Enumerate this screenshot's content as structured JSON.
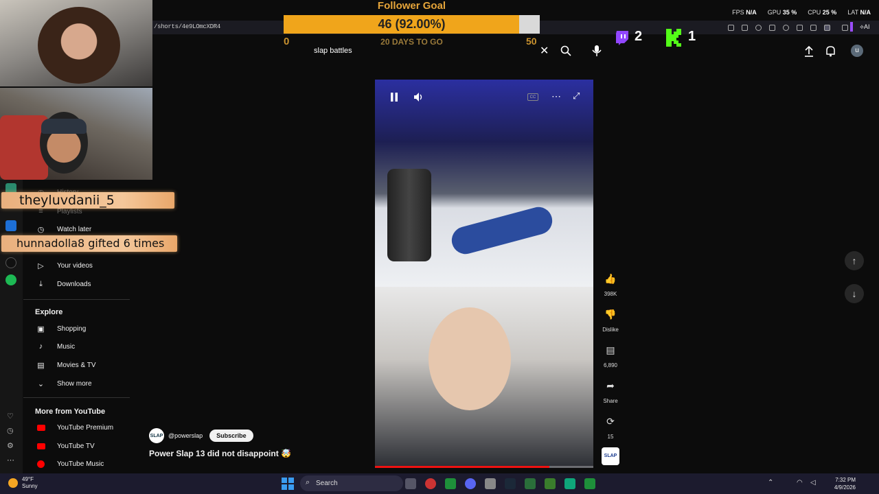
{
  "url": "/shorts/4e9LOmcXDR4",
  "follower_goal": {
    "title": "Follower Goal",
    "current_text": "46 (92.00%)",
    "progress": 0.92,
    "min": "0",
    "max": "50",
    "days": "20 DAYS TO GO"
  },
  "stats": {
    "fps_label": "FPS",
    "fps_value": "N/A",
    "gpu_label": "GPU",
    "gpu_value": "35 %",
    "cpu_label": "CPU",
    "cpu_value": "25 %",
    "lat_label": "LAT",
    "lat_value": "N/A"
  },
  "counters": {
    "twitch": "2",
    "kick": "1"
  },
  "search": {
    "value": "slap battles"
  },
  "alerts": {
    "first": "theyluvdanii_5",
    "second": "hunnadolla8 gifted 6 times"
  },
  "sidebar": {
    "items": [
      {
        "label": "History",
        "icon": "history-icon"
      },
      {
        "label": "Playlists",
        "icon": "playlists-icon"
      },
      {
        "label": "Watch later",
        "icon": "clock-icon"
      },
      {
        "label": "Your videos",
        "icon": "play-icon"
      },
      {
        "label": "Downloads",
        "icon": "download-icon"
      }
    ],
    "explore_heading": "Explore",
    "explore": [
      {
        "label": "Shopping",
        "icon": "bag-icon"
      },
      {
        "label": "Music",
        "icon": "music-icon"
      },
      {
        "label": "Movies & TV",
        "icon": "film-icon"
      },
      {
        "label": "Show more",
        "icon": "chevron-down-icon"
      }
    ],
    "more_heading": "More from YouTube",
    "more": [
      {
        "label": "YouTube Premium"
      },
      {
        "label": "YouTube TV"
      },
      {
        "label": "YouTube Music"
      }
    ]
  },
  "short": {
    "channel": "@powerslap",
    "subscribe": "Subscribe",
    "title": "Power Slap 13 did not disappoint 🤯",
    "channel_logo": "SLAP",
    "progress": 0.8
  },
  "actions": {
    "likes": "398K",
    "dislike": "Dislike",
    "comments": "6,890",
    "share": "Share",
    "remix": "15"
  },
  "taskbar": {
    "temp": "49°F",
    "condition": "Sunny",
    "search": "Search",
    "time": "7:32 PM",
    "date": "4/9/2026"
  },
  "profile_initial": "u"
}
